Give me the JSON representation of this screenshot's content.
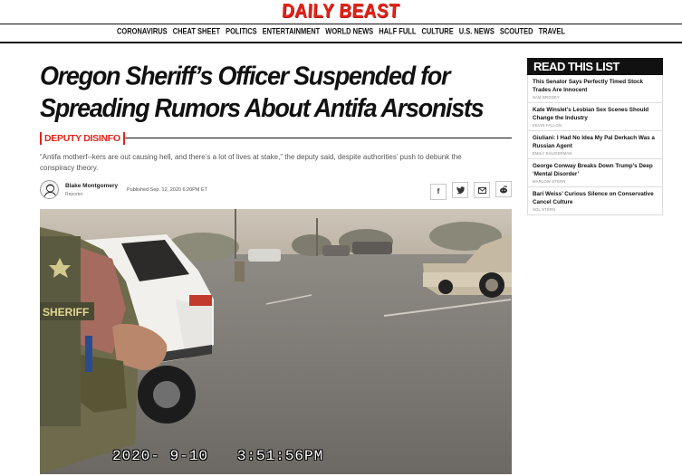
{
  "header": {
    "logo": "DAILY BEAST",
    "nav": [
      "CORONAVIRUS",
      "CHEAT SHEET",
      "POLITICS",
      "ENTERTAINMENT",
      "WORLD NEWS",
      "HALF FULL",
      "CULTURE",
      "U.S. NEWS",
      "SCOUTED",
      "TRAVEL"
    ]
  },
  "article": {
    "headline": "Oregon Sheriff’s Officer Suspended for Spreading Rumors About Antifa Arsonists",
    "rubric": "DEPUTY DISINFO",
    "dek": "“Antifa motherf--kers are out causing hell, and there’s a lot of lives at stake,” the deputy said, despite authorities’ push to debunk the conspiracy theory.",
    "author": "Blake Montgomery",
    "author_role": "Reporter",
    "published": "Published Sep. 12, 2020 6:20PM ET",
    "share_icons": [
      "facebook-icon",
      "twitter-icon",
      "email-icon",
      "reddit-icon"
    ],
    "photo_timestamp": "2020- 9-10   3:51:56PM",
    "photo_badge": "SHERIFF"
  },
  "sidebar": {
    "heading": "READ THIS LIST",
    "items": [
      {
        "title": "This Senator Says Perfectly Timed Stock Trades Are Innocent",
        "author": "SAM BRODEY"
      },
      {
        "title": "Kate Winslet’s Lesbian Sex Scenes Should Change the Industry",
        "author": "KEVIN FALLON"
      },
      {
        "title": "Giuliani: I Had No Idea My Pal Derkach Was a Russian Agent",
        "author": "EMILY SHUGERMAN"
      },
      {
        "title": "George Conway Breaks Down Trump’s Deep ‘Mental Disorder’",
        "author": "MARLOW STERN"
      },
      {
        "title": "Bari Weiss’ Curious Silence on Conservative Cancel Culture",
        "author": "SOL STERN"
      }
    ]
  },
  "colors": {
    "brand_red": "#e1241b",
    "text": "#111111",
    "muted": "#555555"
  }
}
